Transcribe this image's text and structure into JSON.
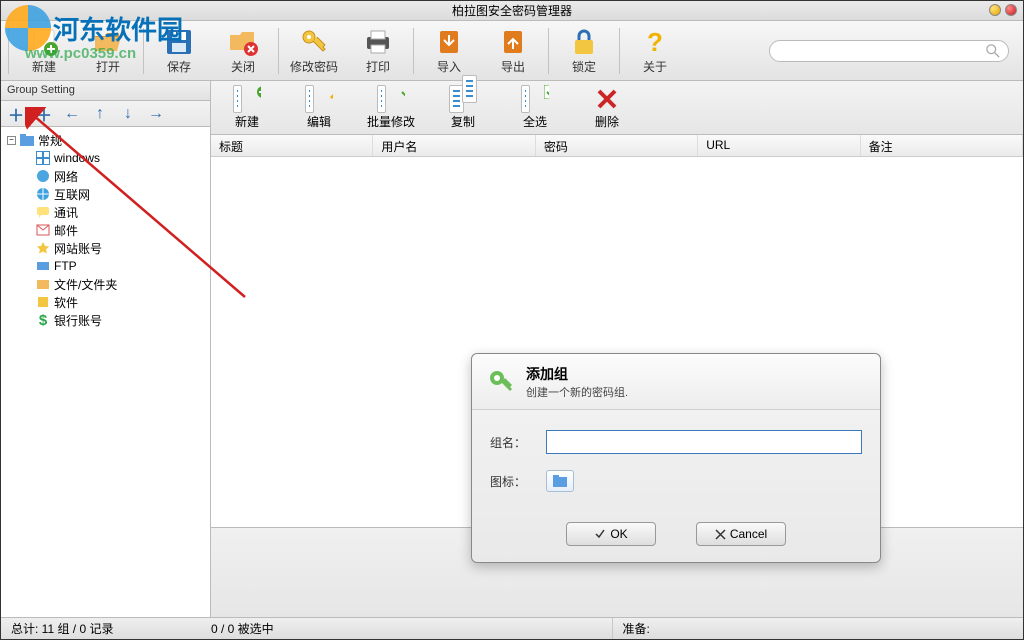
{
  "title": "柏拉图安全密码管理器",
  "watermark": {
    "text": "河东软件园",
    "url": "www.pc0359.cn"
  },
  "toolbar": {
    "new": "新建",
    "open": "打开",
    "save": "保存",
    "close": "关闭",
    "changepw": "修改密码",
    "print": "打印",
    "import": "导入",
    "export": "导出",
    "lock": "锁定",
    "about": "关于"
  },
  "sidebar": {
    "heading": "Group Setting",
    "root": "常规",
    "items": [
      {
        "label": "windows"
      },
      {
        "label": "网络"
      },
      {
        "label": "互联网"
      },
      {
        "label": "通讯"
      },
      {
        "label": "邮件"
      },
      {
        "label": "网站账号"
      },
      {
        "label": "FTP"
      },
      {
        "label": "文件/文件夹"
      },
      {
        "label": "软件"
      },
      {
        "label": "银行账号"
      }
    ]
  },
  "subtoolbar": {
    "new": "新建",
    "edit": "编辑",
    "batch": "批量修改",
    "copy": "复制",
    "selectall": "全选",
    "delete": "删除"
  },
  "columns": {
    "title": "标题",
    "user": "用户名",
    "password": "密码",
    "url": "URL",
    "note": "备注"
  },
  "dialog": {
    "title": "添加组",
    "subtitle": "创建一个新的密码组.",
    "groupname_label": "组名：",
    "icon_label": "图标：",
    "ok": "OK",
    "cancel": "Cancel",
    "groupname_value": ""
  },
  "statusbar": {
    "left": "总计: 11 组 / 0 记录",
    "mid": "0 / 0 被选中",
    "right": "准备:"
  },
  "search": {
    "placeholder": ""
  }
}
